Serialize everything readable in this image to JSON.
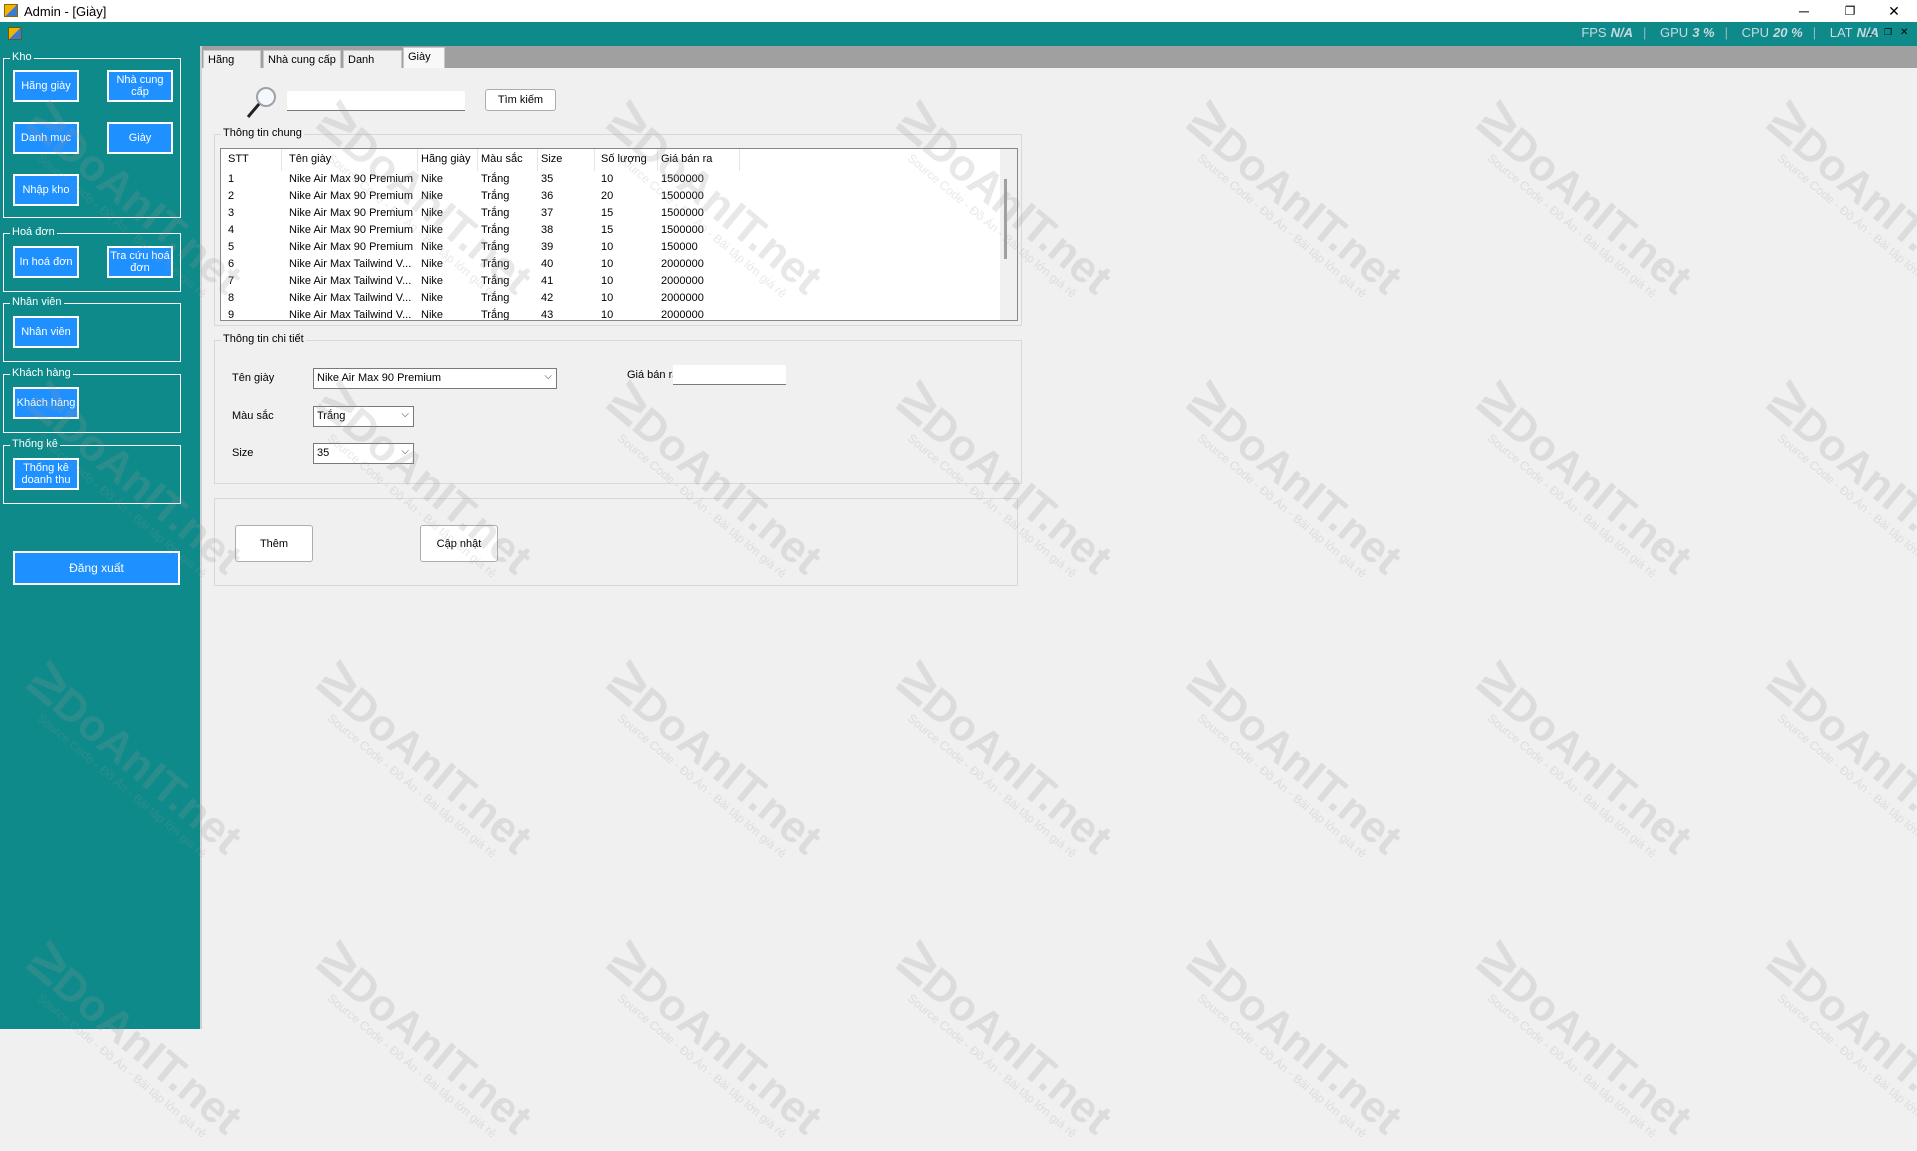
{
  "window": {
    "title": "Admin - [Giày]",
    "controls": {
      "minimize": "─",
      "restore": "❐",
      "close": "✕"
    },
    "mdi_controls": {
      "minimize": "_",
      "restore": "❐",
      "close": "✕"
    }
  },
  "overlay": {
    "items": [
      {
        "label": "FPS",
        "value": "N/A"
      },
      {
        "label": "GPU",
        "value": "3 %"
      },
      {
        "label": "CPU",
        "value": "20 %"
      },
      {
        "label": "LAT",
        "value": "N/A"
      }
    ]
  },
  "sidebar": {
    "groups": {
      "kho": {
        "title": "Kho",
        "buttons": {
          "hang_giay": "Hãng giày",
          "nha_cung_cap": "Nhà cung cấp",
          "danh_muc": "Danh mục",
          "giay": "Giày",
          "nhap_kho": "Nhập kho"
        }
      },
      "hoa_don": {
        "title": "Hoá đơn",
        "buttons": {
          "in_hoa_don": "In hoá đơn",
          "tra_cuu": "Tra cứu hoá đơn"
        }
      },
      "nhan_vien": {
        "title": "Nhân viên",
        "buttons": {
          "nhan_vien": "Nhân viên"
        }
      },
      "khach_hang": {
        "title": "Khách hàng",
        "buttons": {
          "khach_hang": "Khách hàng"
        }
      },
      "thong_ke": {
        "title": "Thống kê",
        "buttons": {
          "doanh_thu": "Thống kê doanh thu"
        }
      }
    },
    "logout": "Đăng xuất"
  },
  "tabs": [
    "Hãng giày",
    "Nhà cung cấp",
    "Danh mục",
    "Giày"
  ],
  "active_tab": 3,
  "search": {
    "value": "",
    "button": "Tìm kiếm"
  },
  "general": {
    "title": "Thông tin chung",
    "columns": [
      "STT",
      "Tên giày",
      "Hãng giày",
      "Màu sắc",
      "Size",
      "Số lượng",
      "Giá bán ra"
    ],
    "rows": [
      [
        "1",
        "Nike Air Max 90 Premium",
        "Nike",
        "Trắng",
        "35",
        "10",
        "1500000"
      ],
      [
        "2",
        "Nike Air Max 90 Premium",
        "Nike",
        "Trắng",
        "36",
        "20",
        "1500000"
      ],
      [
        "3",
        "Nike Air Max 90 Premium",
        "Nike",
        "Trắng",
        "37",
        "15",
        "1500000"
      ],
      [
        "4",
        "Nike Air Max 90 Premium",
        "Nike",
        "Trắng",
        "38",
        "15",
        "1500000"
      ],
      [
        "5",
        "Nike Air Max 90 Premium",
        "Nike",
        "Trắng",
        "39",
        "10",
        "150000"
      ],
      [
        "6",
        "Nike Air Max Tailwind V...",
        "Nike",
        "Trắng",
        "40",
        "10",
        "2000000"
      ],
      [
        "7",
        "Nike Air Max Tailwind V...",
        "Nike",
        "Trắng",
        "41",
        "10",
        "2000000"
      ],
      [
        "8",
        "Nike Air Max Tailwind V...",
        "Nike",
        "Trắng",
        "42",
        "10",
        "2000000"
      ],
      [
        "9",
        "Nike Air Max Tailwind V...",
        "Nike",
        "Trắng",
        "43",
        "10",
        "2000000"
      ]
    ]
  },
  "detail": {
    "title": "Thông tin chi tiết",
    "ten_giay_label": "Tên giày",
    "ten_giay_value": "Nike Air Max 90 Premium",
    "mau_sac_label": "Màu sắc",
    "mau_sac_value": "Trắng",
    "size_label": "Size",
    "size_value": "35",
    "gia_ban_label": "Giá bán ra",
    "gia_ban_value": ""
  },
  "actions": {
    "them": "Thêm",
    "cap_nhat": "Cập nhật"
  },
  "watermark": {
    "brand": "DoAnIT.net",
    "subtitle": "Source Code - Đồ Án - Bài tập lớn giá rẻ"
  },
  "colors": {
    "teal": "#0e8a8a",
    "button_blue": "#1e90ff"
  }
}
